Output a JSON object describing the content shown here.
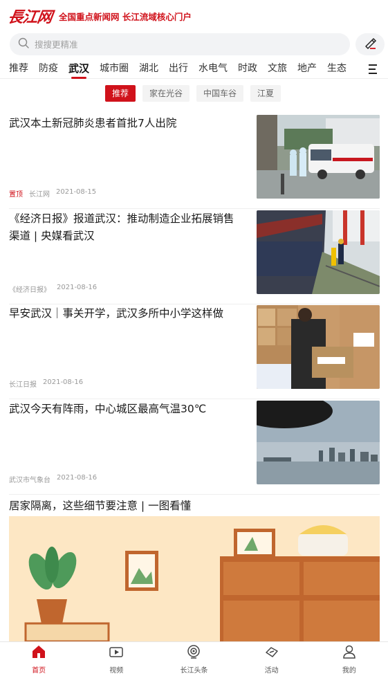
{
  "header": {
    "logo": "長江网",
    "tagline": "全国重点新闻网 长江流域核心门户"
  },
  "search": {
    "placeholder": "搜搜更精准"
  },
  "channels": [
    "推荐",
    "防疫",
    "武汉",
    "城市圈",
    "湖北",
    "出行",
    "水电气",
    "时政",
    "文旅",
    "地产",
    "生态"
  ],
  "active_channel": "武汉",
  "subtabs": [
    "推荐",
    "家在光谷",
    "中国车谷",
    "江夏"
  ],
  "news": [
    {
      "title": "武汉本土新冠肺炎患者首批7人出院",
      "pin": "置顶",
      "source": "长江网",
      "date": "2021-08-15"
    },
    {
      "title": "《经济日报》报道武汉：推动制造企业拓展销售渠道 | 央媒看武汉",
      "pin": "",
      "source": "《经济日报》",
      "date": "2021-08-16"
    },
    {
      "title": "早安武汉｜事关开学，武汉多所中小学这样做",
      "pin": "",
      "source": "长江日报",
      "date": "2021-08-16"
    },
    {
      "title": "武汉今天有阵雨，中心城区最高气温30℃",
      "pin": "",
      "source": "武汉市气象台",
      "date": "2021-08-16"
    }
  ],
  "big_news": {
    "title": "居家隔离，这些细节要注意 | 一图看懂"
  },
  "bottom_nav": [
    {
      "label": "首页",
      "icon": "home-icon",
      "active": true
    },
    {
      "label": "视频",
      "icon": "video-icon",
      "active": false
    },
    {
      "label": "长江头条",
      "icon": "broadcast-icon",
      "active": false
    },
    {
      "label": "活动",
      "icon": "activity-icon",
      "active": false
    },
    {
      "label": "我的",
      "icon": "user-icon",
      "active": false
    }
  ],
  "colors": {
    "brand": "#d0121b"
  }
}
